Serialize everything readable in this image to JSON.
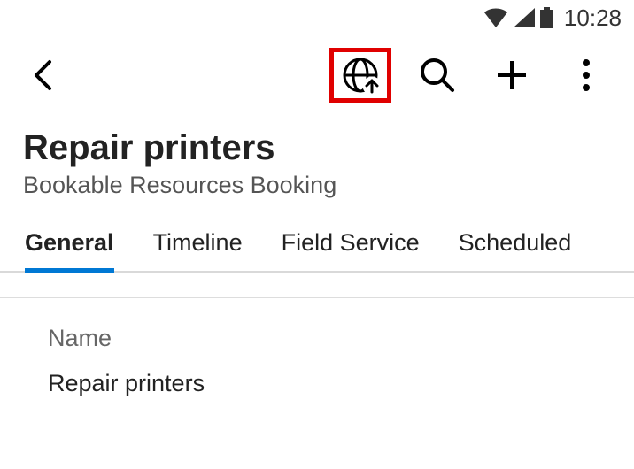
{
  "statusbar": {
    "time": "10:28"
  },
  "header": {
    "title": "Repair printers",
    "subtitle": "Bookable Resources Booking"
  },
  "tabs": [
    {
      "label": "General",
      "active": true
    },
    {
      "label": "Timeline",
      "active": false
    },
    {
      "label": "Field Service",
      "active": false
    },
    {
      "label": "Scheduled",
      "active": false
    }
  ],
  "form": {
    "name_label": "Name",
    "name_value": "Repair printers"
  }
}
